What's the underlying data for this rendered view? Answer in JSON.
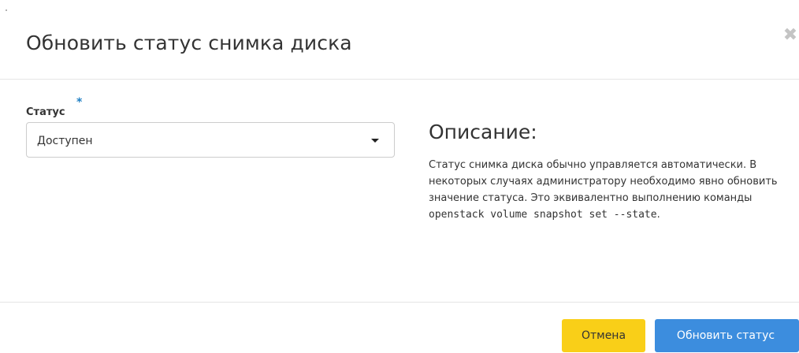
{
  "modal": {
    "title": "Обновить статус снимка диска",
    "close_icon": "close-icon",
    "close_symbol": "✖"
  },
  "form": {
    "status_label": "Статус",
    "required_symbol": "*",
    "status_selected": "Доступен"
  },
  "description": {
    "title": "Описание:",
    "text_before_code": "Статус снимка диска обычно управляется автоматически. В некоторых случаях администратору необходимо явно обновить значение статуса. Это эквивалентно выполнению команды ",
    "code": "openstack volume snapshot set --state",
    "text_after_code": "."
  },
  "footer": {
    "cancel_label": "Отмена",
    "submit_label": "Обновить статус"
  },
  "colors": {
    "cancel_button": "#f9cf18",
    "submit_button": "#3c8dde",
    "required_mark": "#1f7fc3",
    "divider": "#e5e5e5"
  }
}
